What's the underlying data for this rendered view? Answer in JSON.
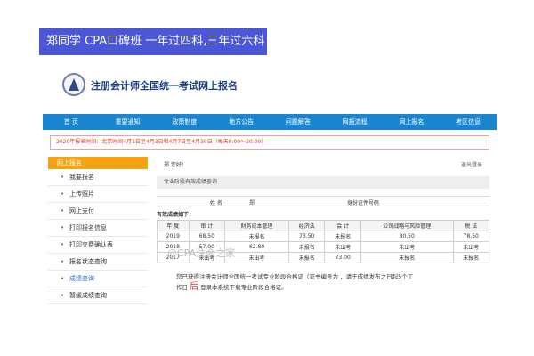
{
  "banner": {
    "text": "郑同学 CPA口碑班  一年过四科,三年过六科"
  },
  "site": {
    "title": "注册会计师全国统一考试网上报名"
  },
  "nav": {
    "items": [
      "首 页",
      "重要通知",
      "政策制度",
      "地方公告",
      "问题解答",
      "网报流程",
      "网上报名",
      "考区信息"
    ]
  },
  "notice": {
    "text": "2020年报名时间：北京时间4月1日至4月3日和4月7日至4月30日（每天8:00～20:00）"
  },
  "sidebar": {
    "title": "网上报名",
    "items": [
      "我要报名",
      "上传照片",
      "网上支付",
      "打印报名信息",
      "打印交费确认表",
      "报名状态查询",
      "成绩查询",
      "暂缓成绩查询"
    ],
    "active_index": 6
  },
  "content": {
    "greeting": "郑    您好!",
    "logout": "退出登录",
    "section_title": "专业阶段有效成绩查询",
    "name_label": "姓    名",
    "name_value": "郑",
    "id_label": "身份证件号码",
    "valid_scores_label": "有效成绩如下：",
    "table": {
      "headers": [
        "年 度",
        "审 计",
        "财务成本管理",
        "经济法",
        "会 计",
        "公司战略与风险管理",
        "税 法"
      ],
      "rows": [
        [
          "2019",
          "68.50",
          "未报名",
          "73.50",
          "未报名",
          "80.50",
          "78.50"
        ],
        [
          "2018",
          "57.00",
          "62.80",
          "未报名",
          "未出考",
          "未出考",
          "未出考"
        ],
        [
          "2017",
          "未出考",
          "未出考",
          "未报名",
          "73.00",
          "未报名",
          "未报名"
        ]
      ]
    },
    "footer_line1": "您已获得注册会计师全国统一考试专业阶段合格证（证书编号为                    ，请于成绩发布之日起5个工",
    "footer_hl": "后",
    "footer_line2_prefix": "作日",
    "footer_line2_suffix": "登录本系统下载专业阶段合格证。"
  },
  "watermark": {
    "text": "@CPA注会之家"
  },
  "colors": {
    "banner": "#4b57d6",
    "nav": "#1a86cf",
    "sidebar_head": "#f3a313",
    "notice": "#d33333"
  }
}
